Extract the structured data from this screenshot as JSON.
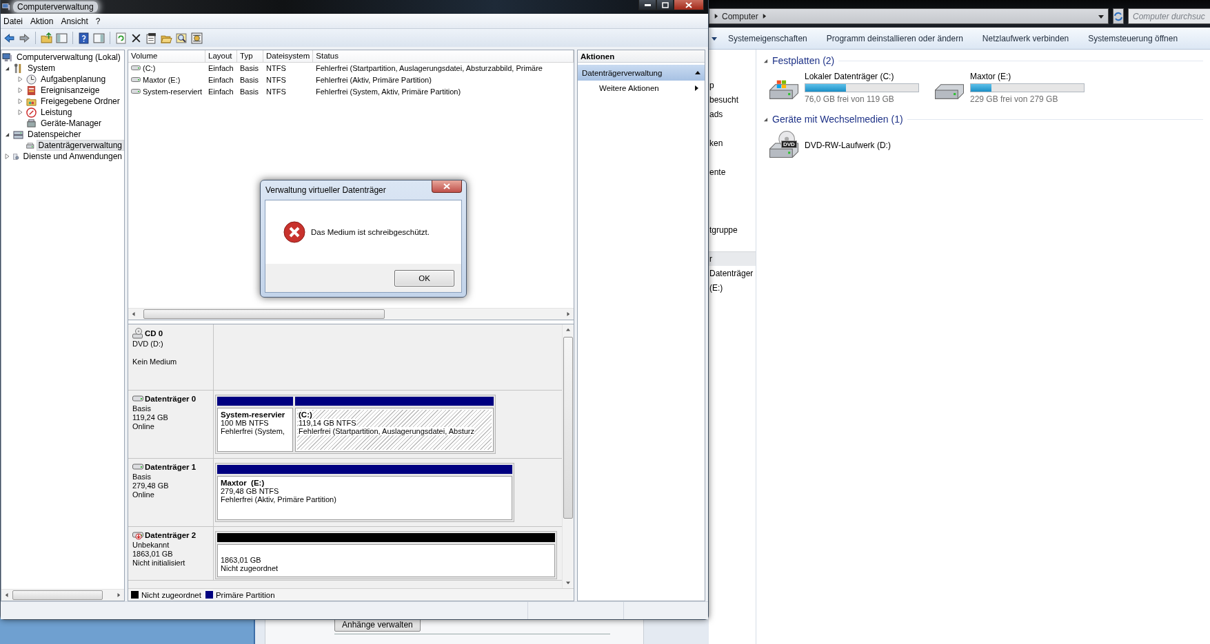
{
  "window": {
    "title": "Computerverwaltung"
  },
  "menu": [
    {
      "label": "Datei"
    },
    {
      "label": "Aktion"
    },
    {
      "label": "Ansicht"
    },
    {
      "label": "?"
    }
  ],
  "tree": [
    {
      "label": "Computerverwaltung (Lokal)",
      "selected": false,
      "children": [
        {
          "label": "System",
          "expanded": true,
          "selected": false,
          "children": [
            {
              "label": "Aufgabenplanung",
              "expanded": false,
              "selected": false
            },
            {
              "label": "Ereignisanzeige",
              "expanded": false,
              "selected": false
            },
            {
              "label": "Freigegebene Ordner",
              "expanded": false,
              "selected": false
            },
            {
              "label": "Leistung",
              "expanded": false,
              "selected": false
            },
            {
              "label": "Geräte-Manager",
              "selected": false
            }
          ]
        },
        {
          "label": "Datenspeicher",
          "expanded": true,
          "selected": false,
          "children": [
            {
              "label": "Datenträgerverwaltung",
              "selected": true
            }
          ]
        },
        {
          "label": "Dienste und Anwendungen",
          "expanded": false,
          "selected": false
        }
      ]
    }
  ],
  "volumes": {
    "columns": [
      "Volume",
      "Layout",
      "Typ",
      "Dateisystem",
      "Status"
    ],
    "rows": [
      [
        "(C:)",
        "Einfach",
        "Basis",
        "NTFS",
        "Fehlerfrei (Startpartition, Auslagerungsdatei, Absturzabbild, Primäre"
      ],
      [
        "Maxtor (E:)",
        "Einfach",
        "Basis",
        "NTFS",
        "Fehlerfrei (Aktiv, Primäre Partition)"
      ],
      [
        "System-reserviert",
        "Einfach",
        "Basis",
        "NTFS",
        "Fehlerfrei (System, Aktiv, Primäre Partition)"
      ]
    ]
  },
  "disks": [
    {
      "kind": "cd",
      "name": "CD 0",
      "type": "DVD (D:)",
      "status": "Kein Medium"
    },
    {
      "kind": "disk",
      "name": "Datenträger 0",
      "type": "Basis",
      "size": "119,24 GB",
      "status": "Online",
      "partitions": [
        {
          "kind": "primary",
          "title": "System-reservier",
          "lines": [
            "100 MB NTFS",
            "Fehlerfrei (System,"
          ],
          "selected": false
        },
        {
          "kind": "primary",
          "title": "(C:)",
          "lines": [
            "119,14 GB NTFS",
            "Fehlerfrei (Startpartition, Auslagerungsdatei, Absturz"
          ],
          "selected": true
        }
      ]
    },
    {
      "kind": "disk",
      "name": "Datenträger 1",
      "type": "Basis",
      "size": "279,48 GB",
      "status": "Online",
      "partitions": [
        {
          "kind": "primary",
          "title": "Maxtor  (E:)",
          "lines": [
            "279,48 GB NTFS",
            "Fehlerfrei (Aktiv, Primäre Partition)"
          ],
          "selected": false
        }
      ]
    },
    {
      "kind": "unknown",
      "name": "Datenträger 2",
      "type": "Unbekannt",
      "size": "1863,01 GB",
      "status": "Nicht initialisiert",
      "partitions": [
        {
          "kind": "unallocated",
          "lines": [
            "1863,01 GB",
            "Nicht zugeordnet"
          ],
          "selected": false
        }
      ]
    }
  ],
  "legend": [
    {
      "label": "Nicht zugeordnet",
      "color": "#000000"
    },
    {
      "label": "Primäre Partition",
      "color": "#000080"
    }
  ],
  "actions": {
    "title": "Aktionen",
    "section": {
      "label": "Datenträgerverwaltung",
      "expanded": true
    },
    "items": [
      {
        "label": "Weitere Aktionen"
      }
    ]
  },
  "dialog": {
    "title": "Verwaltung virtueller Datenträger",
    "kind": "error",
    "message": "Das Medium ist schreibgeschützt.",
    "buttons": [
      "OK"
    ]
  },
  "explorer": {
    "breadcrumb": [
      "Computer"
    ],
    "search": {
      "placeholder": "Computer durchsuc"
    },
    "toolbar": [
      "Systemeigenschaften",
      "Programm deinstallieren oder ändern",
      "Netzlaufwerk verbinden",
      "Systemsteuerung öffnen"
    ],
    "nav": [
      {
        "label": "p",
        "selected": false
      },
      {
        "label": "besucht",
        "selected": false
      },
      {
        "label": "ads",
        "selected": false
      },
      {
        "label": "ken",
        "selected": false
      },
      {
        "label": "ente",
        "selected": false
      },
      {
        "label": "tgruppe",
        "selected": false
      },
      {
        "label": "r",
        "selected": true
      },
      {
        "label": "Datenträger",
        "selected": false
      },
      {
        "label": "(E:)",
        "selected": false
      }
    ],
    "groups": [
      {
        "title": "Festplatten (2)",
        "expanded": true,
        "items": [
          {
            "kind": "system_drive",
            "name": "Lokaler Datenträger (C:)",
            "level": 0.36,
            "free": "76,0 GB frei von 119 GB"
          },
          {
            "kind": "drive",
            "name": "Maxtor (E:)",
            "level": 0.18,
            "free": "229 GB frei von 279 GB"
          }
        ]
      },
      {
        "title": "Geräte mit Wechselmedien (1)",
        "expanded": true,
        "items": [
          {
            "kind": "dvd",
            "name": "DVD-RW-Laufwerk (D:)",
            "badge": "DVD"
          }
        ]
      }
    ]
  },
  "mail_window": {
    "button": "Anhänge verwalten"
  }
}
